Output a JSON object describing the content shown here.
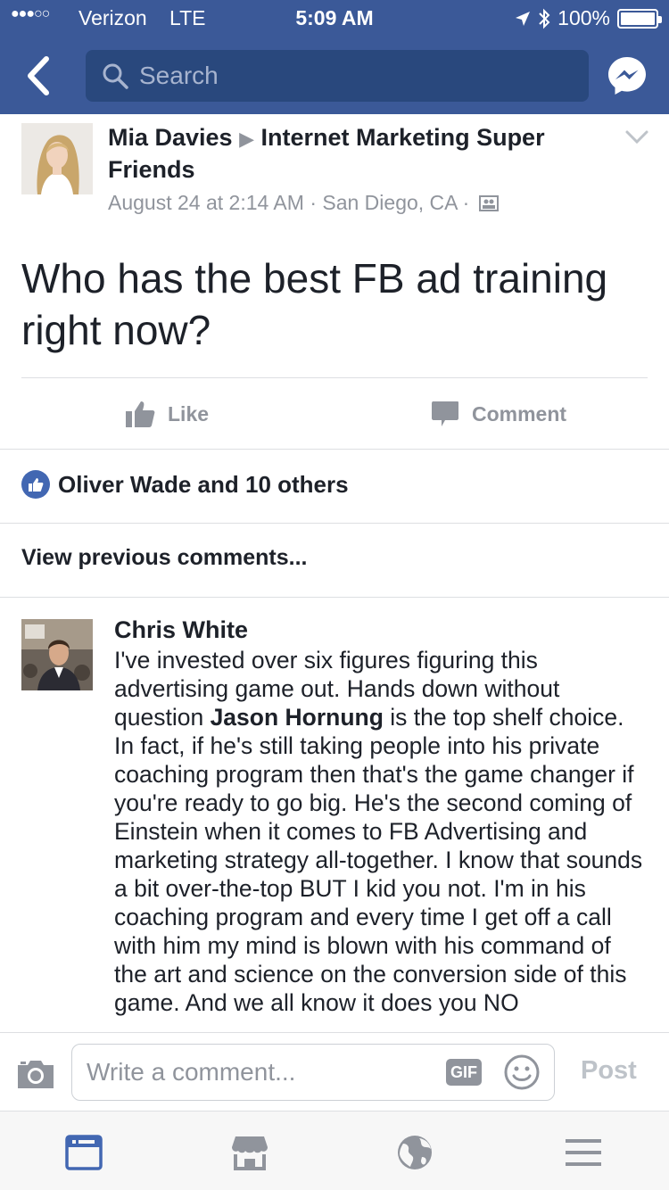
{
  "status_bar": {
    "signal": "●●●○○",
    "carrier": "Verizon",
    "network": "LTE",
    "time": "5:09 AM",
    "battery": "100%",
    "battery_level": 1.0
  },
  "nav": {
    "search_placeholder": "Search"
  },
  "post": {
    "author": "Mia Davies",
    "separator": "▶",
    "group": "Internet Marketing Super Friends",
    "meta": "August 24 at 2:14 AM · San Diego, CA ·",
    "body": "Who has the best FB ad training right now?"
  },
  "actions": {
    "like": "Like",
    "comment": "Comment"
  },
  "likes": {
    "text": "Oliver Wade and 10 others"
  },
  "view_previous": "View previous comments...",
  "comment": {
    "author": "Chris White",
    "text_before": "I've invested over six figures figuring this advertising game out. Hands down without question ",
    "mention": "Jason Hornung",
    "text_after": " is the top shelf choice. In fact, if he's still taking people into his private coaching program then that's the game changer if you're ready to go big. He's the second coming of Einstein when it comes to FB Advertising and marketing strategy all-together. I know that sounds a bit over-the-top BUT I kid you not. I'm in his coaching program and every time I get off a call with him my mind is blown with his command of the art and science on the conversion side of this game. And we all know it does you NO"
  },
  "composer": {
    "placeholder": "Write a comment...",
    "gif": "GIF",
    "post": "Post"
  },
  "colors": {
    "header": "#3b5998",
    "search_bg": "#29487d",
    "link_blue": "#4267b2",
    "muted": "#90949c"
  },
  "icons": {
    "back": "chevron-left-icon",
    "search": "search-icon",
    "messenger": "messenger-icon",
    "like": "thumbs-up-icon",
    "comment": "comment-bubble-icon",
    "camera": "camera-icon",
    "smile": "smile-icon",
    "nav": [
      "news-feed-icon",
      "marketplace-icon",
      "globe-icon",
      "menu-icon"
    ]
  }
}
